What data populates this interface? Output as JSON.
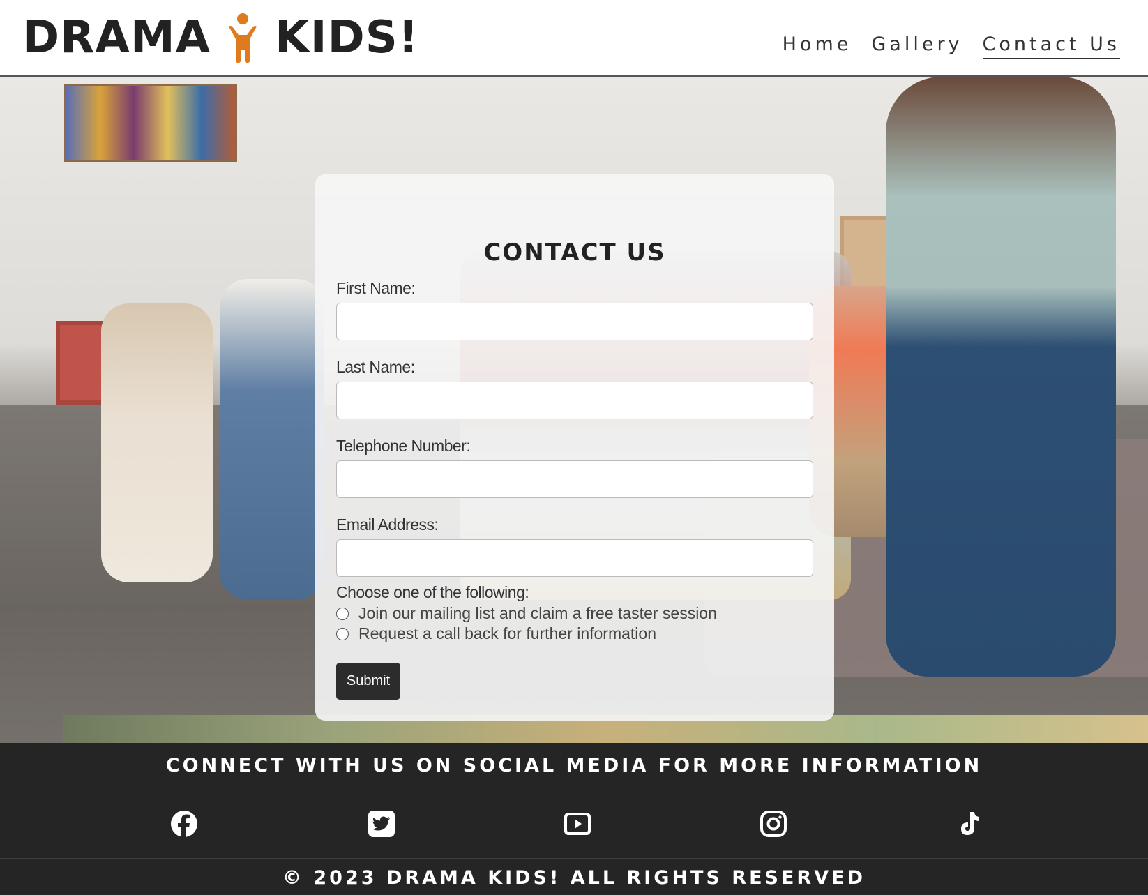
{
  "header": {
    "logo_left": "DRAMA",
    "logo_right": "KIDS!",
    "logo_figure_color": "#e07a1f",
    "nav": [
      {
        "label": "Home",
        "active": false
      },
      {
        "label": "Gallery",
        "active": false
      },
      {
        "label": "Contact Us",
        "active": true
      }
    ]
  },
  "form": {
    "title": "CONTACT US",
    "fields": [
      {
        "label": "First Name:",
        "value": ""
      },
      {
        "label": "Last Name:",
        "value": ""
      },
      {
        "label": "Telephone Number:",
        "value": ""
      },
      {
        "label": "Email Address:",
        "value": ""
      }
    ],
    "choose_label": "Choose one of the following:",
    "options": [
      {
        "label": "Join our mailing list and claim a free taster session",
        "checked": false
      },
      {
        "label": "Request a call back for further information",
        "checked": false
      }
    ],
    "submit_label": "Submit"
  },
  "footer": {
    "connect_text": "CONNECT WITH US ON SOCIAL MEDIA FOR MORE INFORMATION",
    "social_icons": [
      "facebook-icon",
      "twitter-icon",
      "youtube-icon",
      "instagram-icon",
      "tiktok-icon"
    ],
    "copyright": "© 2023 DRAMA KIDS! ALL RIGHTS RESERVED"
  }
}
